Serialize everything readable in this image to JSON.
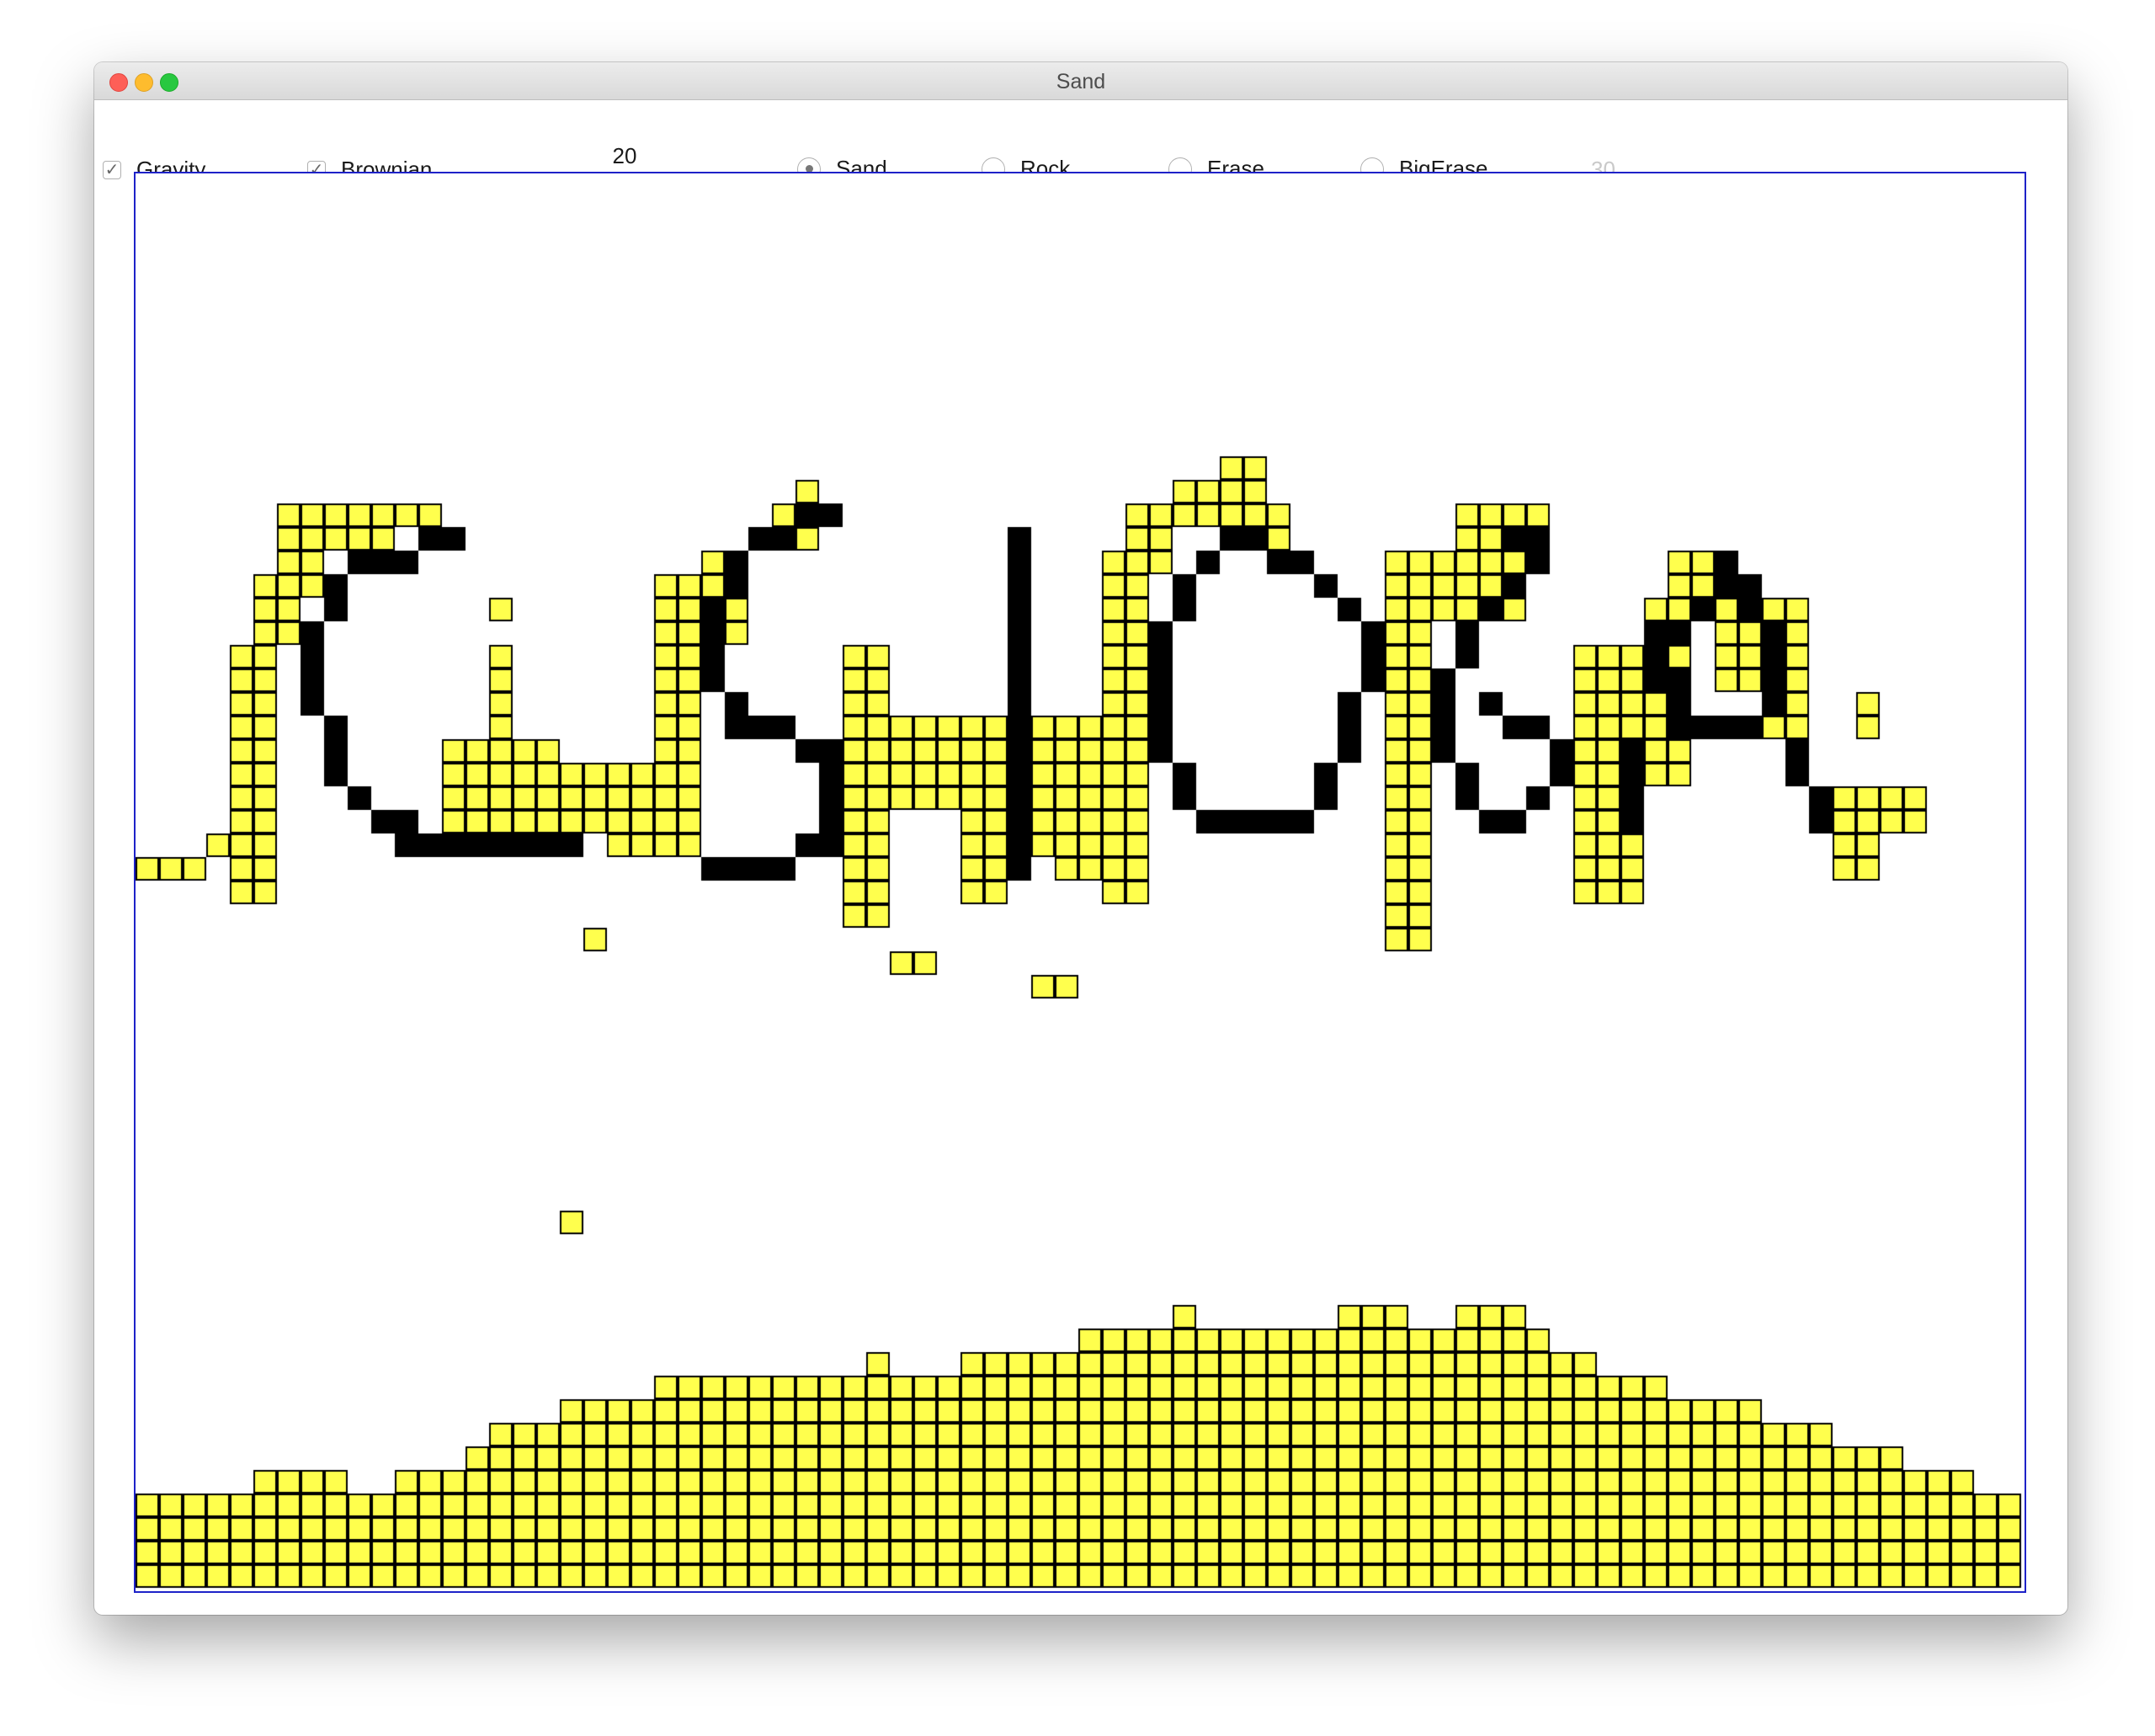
{
  "window": {
    "title": "Sand"
  },
  "toolbar": {
    "gravity_label": "Gravity",
    "gravity_checked": true,
    "brownian_label": "Brownian",
    "brownian_checked": true,
    "slider_value": "20",
    "slider_fraction": 0.1,
    "modes": [
      {
        "label": "Sand",
        "selected": true
      },
      {
        "label": "Rock",
        "selected": false
      },
      {
        "label": "Erase",
        "selected": false
      },
      {
        "label": "BigErase",
        "selected": false
      }
    ],
    "readout": "30"
  },
  "icons": {
    "check": "checkmark-icon"
  },
  "colors": {
    "sand": "#ffff4d",
    "rock": "#000000",
    "cell_border": "#000000",
    "canvas_border": "#1e22c8"
  },
  "grid": {
    "cols": 80,
    "rows": 60
  }
}
